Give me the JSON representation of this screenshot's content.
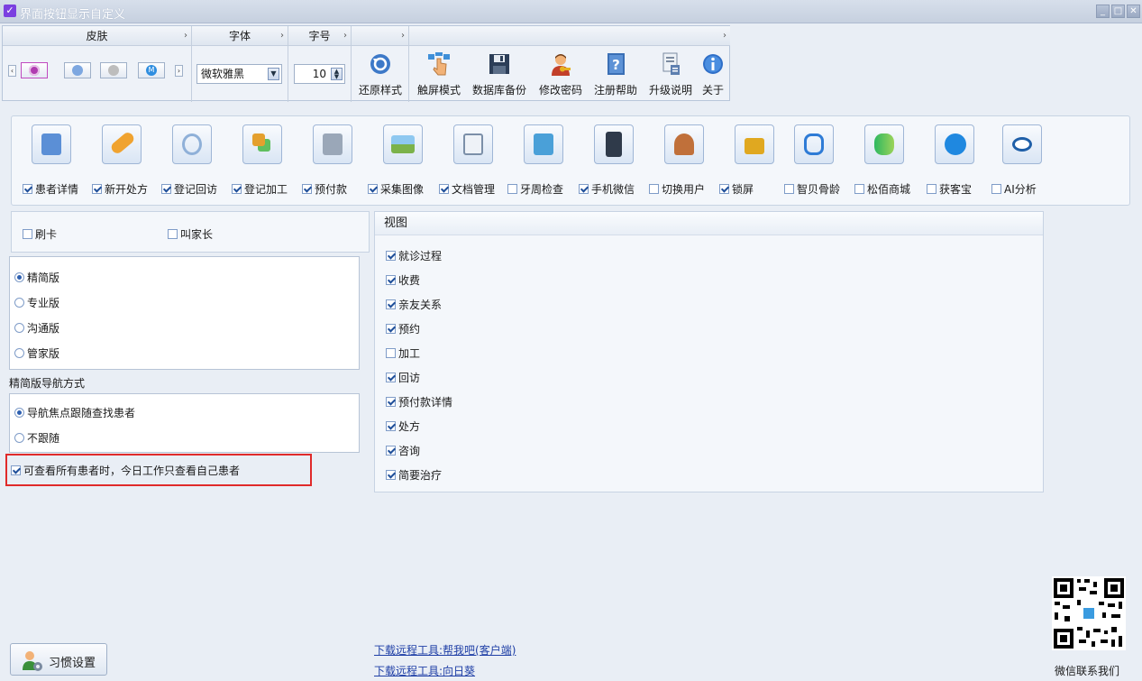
{
  "window": {
    "title": "界面按钮显示自定义",
    "controls": [
      "_",
      "□",
      "✕"
    ]
  },
  "ribbon": {
    "skin": {
      "header": "皮肤",
      "buttons": [
        {
          "name": "skin-purple",
          "color": "#b03cb0"
        },
        {
          "name": "skin-blue",
          "color": "#7da7e0"
        },
        {
          "name": "skin-gray",
          "color": "#bdbdbd"
        },
        {
          "name": "skin-blue-m",
          "color": "#2f8ee0"
        }
      ],
      "prev": "‹",
      "next": "›"
    },
    "font": {
      "header": "字体",
      "value": "微软雅黑"
    },
    "fontsize": {
      "header": "字号",
      "value": "10"
    },
    "restore": {
      "header": "",
      "label": "还原样式"
    },
    "tools": {
      "header": "",
      "buttons": [
        {
          "label": "触屏模式",
          "icon": "touch-icon"
        },
        {
          "label": "数据库备份",
          "icon": "save-disk-icon"
        },
        {
          "label": "修改密码",
          "icon": "user-key-icon"
        },
        {
          "label": "注册帮助",
          "icon": "help-book-icon"
        },
        {
          "label": "升级说明",
          "icon": "document-icon"
        },
        {
          "label": "关于",
          "icon": "info-icon"
        }
      ]
    },
    "expand_arrow": "›"
  },
  "modules": [
    {
      "label": "患者详情",
      "checked": true,
      "icon": "patient-card-icon",
      "color": "#5b8fd6"
    },
    {
      "label": "新开处方",
      "checked": true,
      "icon": "pill-icon",
      "color": "#f0a330"
    },
    {
      "label": "登记回访",
      "checked": true,
      "icon": "refresh-icon",
      "color": "#8fb0d8"
    },
    {
      "label": "登记加工",
      "checked": true,
      "icon": "cubes-icon",
      "color": "#e4a02e"
    },
    {
      "label": "预付款",
      "checked": true,
      "icon": "calculator-icon",
      "color": "#9aa7b8"
    },
    {
      "label": "采集图像",
      "checked": true,
      "icon": "image-icon",
      "color": "#7bb24a"
    },
    {
      "label": "文档管理",
      "checked": true,
      "icon": "document-user-icon",
      "color": "#7b8fa8"
    },
    {
      "label": "牙周检查",
      "checked": false,
      "icon": "tooth-clipboard-icon",
      "color": "#4aa0d8"
    },
    {
      "label": "手机微信",
      "checked": true,
      "icon": "phone-icon",
      "color": "#2f3a4a"
    },
    {
      "label": "切换用户",
      "checked": false,
      "icon": "users-icon",
      "color": "#c0703a"
    },
    {
      "label": "锁屏",
      "checked": true,
      "icon": "lock-icon",
      "color": "#e0a820"
    },
    {
      "label": "智贝骨龄",
      "checked": false,
      "icon": "bone-age-icon",
      "color": "#2e7bd6"
    },
    {
      "label": "松佰商城",
      "checked": false,
      "icon": "mall-logo-icon",
      "color": "#2eb860"
    },
    {
      "label": "获客宝",
      "checked": false,
      "icon": "acquire-icon",
      "color": "#1f88e0"
    },
    {
      "label": "AI分析",
      "checked": false,
      "icon": "eye-icon",
      "color": "#1f5fa8"
    }
  ],
  "options_top": [
    {
      "label": "刷卡",
      "checked": false
    },
    {
      "label": "叫家长",
      "checked": false
    }
  ],
  "editions": [
    {
      "label": "精简版",
      "selected": true
    },
    {
      "label": "专业版",
      "selected": false
    },
    {
      "label": "沟通版",
      "selected": false
    },
    {
      "label": "管家版",
      "selected": false
    }
  ],
  "nav_mode": {
    "title": "精简版导航方式",
    "options": [
      {
        "label": "导航焦点跟随查找患者",
        "selected": true
      },
      {
        "label": "不跟随",
        "selected": false
      }
    ]
  },
  "today_option": {
    "label": "可查看所有患者时，今日工作只查看自己患者",
    "checked": true
  },
  "view": {
    "title": "视图",
    "items": [
      {
        "label": "就诊过程",
        "checked": true
      },
      {
        "label": "收费",
        "checked": true
      },
      {
        "label": "亲友关系",
        "checked": true
      },
      {
        "label": "预约",
        "checked": true
      },
      {
        "label": "加工",
        "checked": false
      },
      {
        "label": "回访",
        "checked": true
      },
      {
        "label": "预付款详情",
        "checked": true
      },
      {
        "label": "处方",
        "checked": true
      },
      {
        "label": "咨询",
        "checked": true
      },
      {
        "label": "简要治疗",
        "checked": true
      }
    ]
  },
  "footer": {
    "habit_button": "习惯设置",
    "links": [
      "下载远程工具:帮我吧(客户端)",
      "下载远程工具:向日葵"
    ],
    "qr_caption": "微信联系我们"
  }
}
